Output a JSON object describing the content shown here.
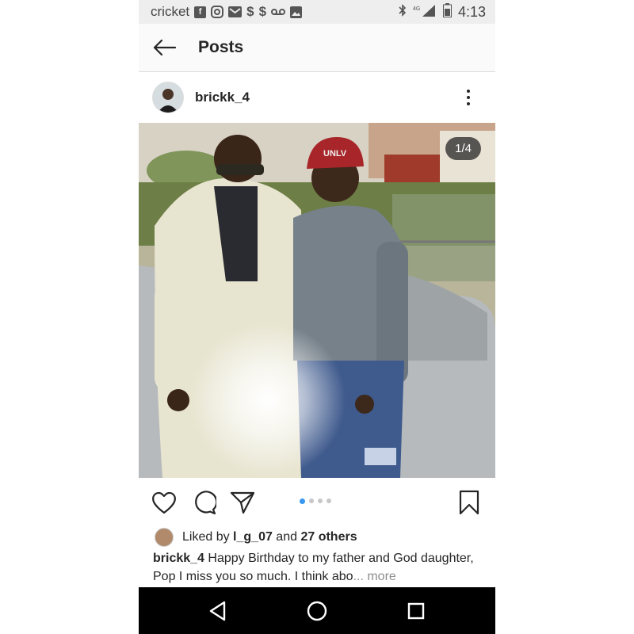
{
  "status_bar": {
    "carrier": "cricket",
    "time": "4:13",
    "icons": [
      "facebook-icon",
      "instagram-icon",
      "gmail-icon",
      "dollar-icon",
      "dollar-icon",
      "voicemail-icon",
      "image-icon",
      "bluetooth-icon",
      "lte-signal-icon",
      "battery-icon"
    ]
  },
  "appbar": {
    "title": "Posts"
  },
  "post": {
    "username": "brickk_4",
    "image_counter": "1/4",
    "carousel": {
      "count": 4,
      "active": 1
    },
    "likes": {
      "prefix": "Liked by ",
      "user": "l_g_07",
      "middle": " and ",
      "others": "27 others"
    },
    "caption": {
      "username": "brickk_4",
      "text": " Happy Birthday to my father and God daughter, Pop I miss you so much. I think abo",
      "ellipsis": "...",
      "more": " more"
    }
  },
  "colors": {
    "accent": "#3897f0",
    "text": "#262626",
    "muted": "#8e8e8e"
  }
}
